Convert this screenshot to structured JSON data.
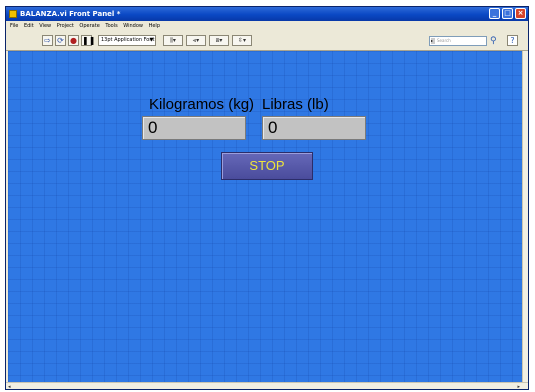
{
  "window": {
    "title": "BALANZA.vi Front Panel *",
    "controls": [
      "_",
      "□",
      "×"
    ]
  },
  "menu": [
    "File",
    "Edit",
    "View",
    "Project",
    "Operate",
    "Tools",
    "Window",
    "Help"
  ],
  "toolbar": {
    "font": "13pt Application Font",
    "search_placeholder": "Search",
    "help_label": "?"
  },
  "panel": {
    "kg_label": "Kilogramos (kg)",
    "kg_value": "0",
    "lb_label": "Libras (lb)",
    "lb_value": "0",
    "stop_label": "STOP"
  },
  "colors": {
    "panel_bg": "#2f78e4",
    "stop_button": "#5557a8",
    "stop_text": "#f0e63a",
    "indicator": "#c2c2c2"
  }
}
